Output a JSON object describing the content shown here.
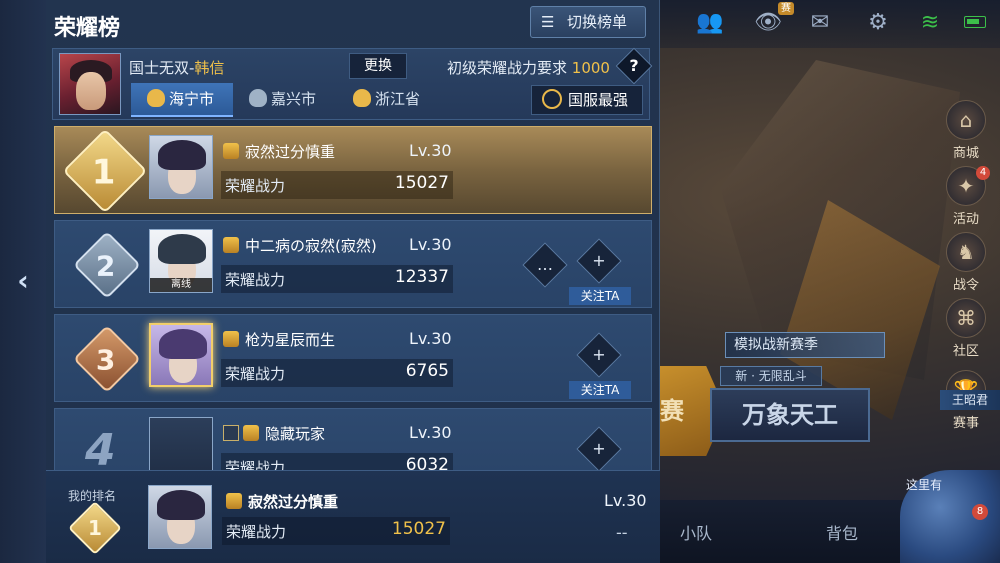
{
  "panel": {
    "title": "荣耀榜",
    "switch_label": "切换榜单"
  },
  "hero": {
    "prefix": "国士无双-",
    "name": "韩信",
    "change_label": "更换",
    "requirement_label": "初级荣耀战力要求",
    "requirement_value": "1000",
    "help_label": "?"
  },
  "tabs": [
    {
      "label": "海宁市",
      "active": true
    },
    {
      "label": "嘉兴市",
      "active": false
    },
    {
      "label": "浙江省",
      "active": false
    }
  ],
  "national_label": "国服最强",
  "power_label": "荣耀战力",
  "rows": [
    {
      "rank": "1",
      "name": "寂然过分慎重",
      "level": "Lv.30",
      "power": "15027"
    },
    {
      "rank": "2",
      "name": "中二病の寂然(寂然)",
      "level": "Lv.30",
      "power": "12337",
      "status": "离线",
      "follow": "关注TA"
    },
    {
      "rank": "3",
      "name": "枪为星辰而生",
      "level": "Lv.30",
      "power": "6765",
      "follow": "关注TA"
    },
    {
      "rank": "4",
      "name": "隐藏玩家",
      "level": "Lv.30",
      "power": "6032"
    }
  ],
  "my_rank": {
    "title": "我的排名",
    "rank": "1",
    "name": "寂然过分慎重",
    "level": "Lv.30",
    "power": "15027",
    "extra": "--"
  },
  "game_ui": {
    "top_badge": "赛",
    "side_items": [
      {
        "label": "商城",
        "icon": "shop-icon"
      },
      {
        "label": "活动",
        "icon": "activity-icon",
        "badge": "4"
      },
      {
        "label": "战令",
        "icon": "battle-pass-icon"
      },
      {
        "label": "社区",
        "icon": "community-icon"
      },
      {
        "label": "赛事",
        "icon": "trophy-icon"
      }
    ],
    "side_tag": "王昭君",
    "mode_sub1": "模拟战新赛季",
    "mode_sub2": "新 · 无限乱斗",
    "mode_main": "万象天工",
    "mode_left": "赛",
    "bottom_team": "小队",
    "bottom_bag": "背包",
    "bottom_circle_text": "这里有",
    "bottom_circle_badge": "8"
  },
  "colors": {
    "accent_gold": "#f0c14a",
    "panel_bg": "#22344f",
    "active_tab": "#3f74b8"
  }
}
